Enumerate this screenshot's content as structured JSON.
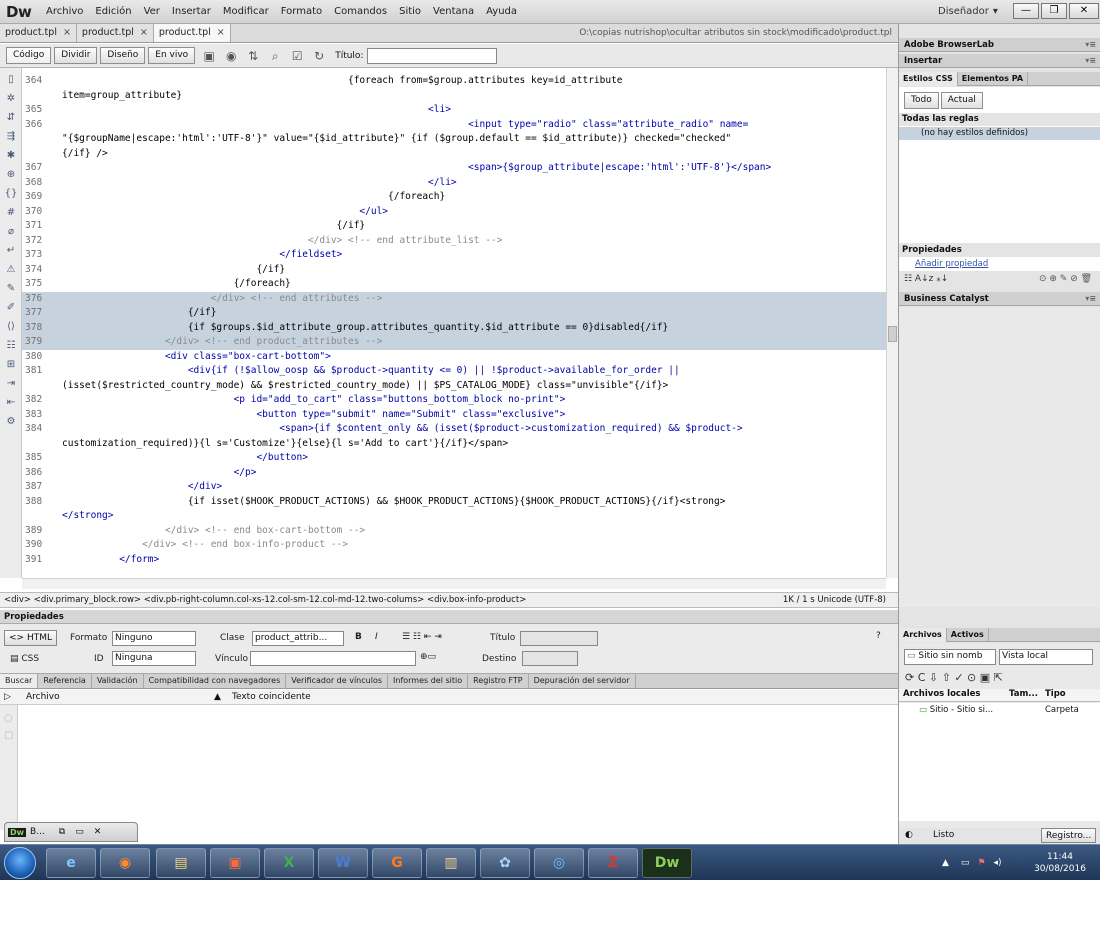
{
  "app": {
    "logo": "Dw",
    "menus": [
      "Archivo",
      "Edición",
      "Ver",
      "Insertar",
      "Modificar",
      "Formato",
      "Comandos",
      "Sitio",
      "Ventana",
      "Ayuda"
    ],
    "workspace": "Diseñador",
    "workspace_arrow": "▾",
    "win_min": "—",
    "win_restore": "❐",
    "win_close": "✕"
  },
  "doc_tabs": [
    {
      "label": "product.tpl",
      "close": "×"
    },
    {
      "label": "product.tpl",
      "close": "×"
    },
    {
      "label": "product.tpl",
      "close": "×"
    }
  ],
  "doc_path": "O:\\copias nutrishop\\ocultar atributos sin stock\\modificado\\product.tpl",
  "toolbar": {
    "code": "Código",
    "split": "Dividir",
    "design": "Diseño",
    "live": "En vivo",
    "title_label": "Título:"
  },
  "code_lines": [
    {
      "n": "364",
      "t": "                                                  {foreach from=$group.attributes key=id_attribute",
      "hl": false
    },
    {
      "n": "",
      "t": "item=group_attribute}",
      "hl": false
    },
    {
      "n": "365",
      "t": "                                                                <li>",
      "hl": false
    },
    {
      "n": "366",
      "t": "                                                                       <input type=\"radio\" class=\"attribute_radio\" name=",
      "hl": false
    },
    {
      "n": "",
      "t": "\"{$groupName|escape:'html':'UTF-8'}\" value=\"{$id_attribute}\" {if ($group.default == $id_attribute)} checked=\"checked\"",
      "hl": false
    },
    {
      "n": "",
      "t": "{/if} />",
      "hl": false
    },
    {
      "n": "367",
      "t": "                                                                       <span>{$group_attribute|escape:'html':'UTF-8'}</span>",
      "hl": false
    },
    {
      "n": "368",
      "t": "                                                                </li>",
      "hl": false
    },
    {
      "n": "369",
      "t": "                                                         {/foreach}",
      "hl": false
    },
    {
      "n": "370",
      "t": "                                                    </ul>",
      "hl": false
    },
    {
      "n": "371",
      "t": "                                                {/if}",
      "hl": false
    },
    {
      "n": "372",
      "t": "                                           </div> <!-- end attribute_list -->",
      "hl": false
    },
    {
      "n": "373",
      "t": "                                      </fieldset>",
      "hl": false
    },
    {
      "n": "374",
      "t": "                                  {/if}",
      "hl": false
    },
    {
      "n": "375",
      "t": "                              {/foreach}",
      "hl": false
    },
    {
      "n": "376",
      "t": "                          </div> <!-- end attributes -->",
      "hl": true
    },
    {
      "n": "377",
      "t": "                      {/if}",
      "hl": true
    },
    {
      "n": "378",
      "t": "                      {if $groups.$id_attribute_group.attributes_quantity.$id_attribute == 0}disabled{/if}",
      "hl": true
    },
    {
      "n": "379",
      "t": "                  </div> <!-- end product_attributes -->",
      "hl": true
    },
    {
      "n": "380",
      "t": "                  <div class=\"box-cart-bottom\">",
      "hl": false
    },
    {
      "n": "381",
      "t": "                      <div{if (!$allow_oosp && $product->quantity <= 0) || !$product->available_for_order ||",
      "hl": false
    },
    {
      "n": "",
      "t": "(isset($restricted_country_mode) && $restricted_country_mode) || $PS_CATALOG_MODE} class=\"unvisible\"{/if}>",
      "hl": false
    },
    {
      "n": "382",
      "t": "                              <p id=\"add_to_cart\" class=\"buttons_bottom_block no-print\">",
      "hl": false
    },
    {
      "n": "383",
      "t": "                                  <button type=\"submit\" name=\"Submit\" class=\"exclusive\">",
      "hl": false
    },
    {
      "n": "384",
      "t": "                                      <span>{if $content_only && (isset($product->customization_required) && $product->",
      "hl": false
    },
    {
      "n": "",
      "t": "customization_required)}{l s='Customize'}{else}{l s='Add to cart'}{/if}</span>",
      "hl": false
    },
    {
      "n": "385",
      "t": "                                  </button>",
      "hl": false
    },
    {
      "n": "386",
      "t": "                              </p>",
      "hl": false
    },
    {
      "n": "387",
      "t": "                      </div>",
      "hl": false
    },
    {
      "n": "388",
      "t": "                      {if isset($HOOK_PRODUCT_ACTIONS) && $HOOK_PRODUCT_ACTIONS}{$HOOK_PRODUCT_ACTIONS}{/if}<strong>",
      "hl": false
    },
    {
      "n": "",
      "t": "</strong>",
      "hl": false
    },
    {
      "n": "389",
      "t": "                  </div> <!-- end box-cart-bottom -->",
      "hl": false
    },
    {
      "n": "390",
      "t": "              </div> <!-- end box-info-product -->",
      "hl": false
    },
    {
      "n": "391",
      "t": "          </form>",
      "hl": false
    }
  ],
  "status": {
    "tag_selector": "<div> <div.primary_block.row> <div.pb-right-column.col-xs-12.col-sm-12.col-md-12.two-colums> <div.box-info-product>",
    "info": "1K / 1 s  Unicode (UTF-8)"
  },
  "properties": {
    "header": "Propiedades",
    "html_btn": "<> HTML",
    "css_btn": "CSS",
    "format_label": "Formato",
    "format_value": "Ninguno",
    "class_label": "Clase",
    "class_value": "product_attrib...",
    "bold": "B",
    "italic": "I",
    "list_icons": "☰ ☷ ⇤ ⇥",
    "title_label": "Título",
    "id_label": "ID",
    "id_value": "Ninguna",
    "link_label": "Vínculo",
    "target_label": "Destino",
    "help": "?"
  },
  "results": {
    "tabs": [
      "Buscar",
      "Referencia",
      "Validación",
      "Compatibilidad con navegadores",
      "Verificador de vínculos",
      "Informes del sitio",
      "Registro FTP",
      "Depuración del servidor"
    ],
    "col_file": "Archivo",
    "col_match": "Texto coincidente"
  },
  "minimized": {
    "label": "B...",
    "dw": "Dw"
  },
  "right": {
    "browserlab": "Adobe BrowserLab",
    "insert": "Insertar",
    "css_tab": "Estilos CSS",
    "ap_tab": "Elementos PA",
    "all_btn": "Todo",
    "current_btn": "Actual",
    "all_rules": "Todas las reglas",
    "no_styles": "(no hay estilos definidos)",
    "props_header": "Propiedades",
    "add_prop": "Añadir propiedad",
    "business": "Business Catalyst",
    "files_tab": "Archivos",
    "assets_tab": "Activos",
    "site_select": "Sitio sin nomb",
    "view_select": "Vista local",
    "col_local": "Archivos locales",
    "col_size": "Tam...",
    "col_type": "Tipo",
    "site_item": "Sitio - Sitio si...",
    "site_type": "Carpeta",
    "ready": "Listo",
    "log_btn": "Registro..."
  },
  "taskbar": {
    "time": "11:44",
    "date": "30/08/2016"
  }
}
